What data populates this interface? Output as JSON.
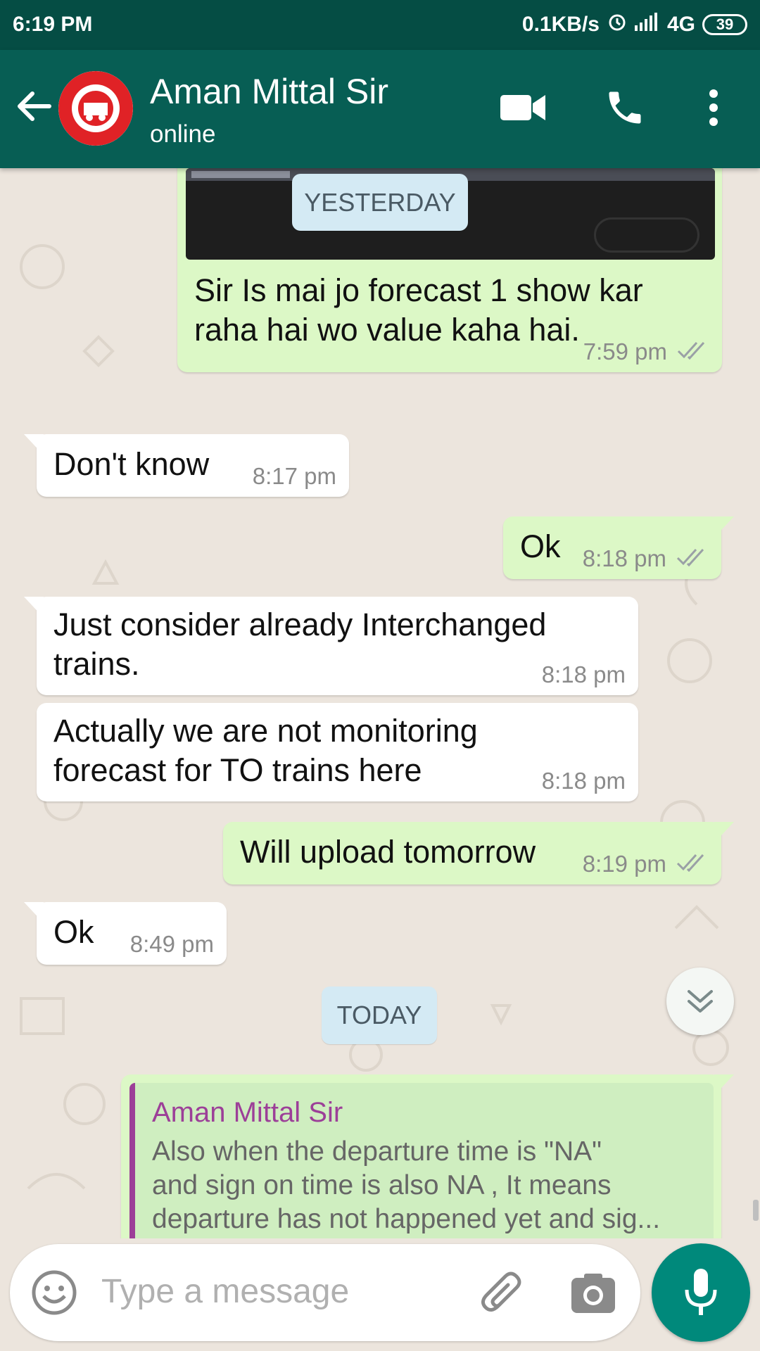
{
  "status_bar": {
    "time": "6:19 PM",
    "data_speed": "0.1KB/s",
    "network": "4G",
    "battery": "39"
  },
  "header": {
    "contact_name": "Aman Mittal Sir",
    "contact_status": "online",
    "accent_color": "#075e54"
  },
  "chat": {
    "date_yesterday": "YESTERDAY",
    "date_today": "TODAY",
    "messages": [
      {
        "direction": "out",
        "text_line1": "Sir Is mai jo forecast 1 show kar",
        "text_line2": "raha hai wo value kaha hai.",
        "time": "7:59 pm",
        "has_image": true
      },
      {
        "direction": "in",
        "text": "Don't know",
        "time": "8:17 pm"
      },
      {
        "direction": "out",
        "text": "Ok",
        "time": "8:18 pm"
      },
      {
        "direction": "in",
        "text_line1": "Just consider already Interchanged",
        "text_line2": "trains.",
        "time": "8:18 pm"
      },
      {
        "direction": "in",
        "text_line1": "Actually we are not monitoring",
        "text_line2": "forecast for TO trains here",
        "time": "8:18 pm"
      },
      {
        "direction": "out",
        "text": "Will upload tomorrow",
        "time": "8:19 pm"
      },
      {
        "direction": "in",
        "text": "Ok",
        "time": "8:49 pm"
      },
      {
        "direction": "out",
        "quote": {
          "author": "Aman Mittal Sir",
          "line1": "Also when the departure time is \"NA\"",
          "line2": "and sign on time is also NA , It means",
          "line3": "departure has not happened yet and sig..."
        }
      }
    ]
  },
  "composer": {
    "placeholder": "Type a message"
  }
}
